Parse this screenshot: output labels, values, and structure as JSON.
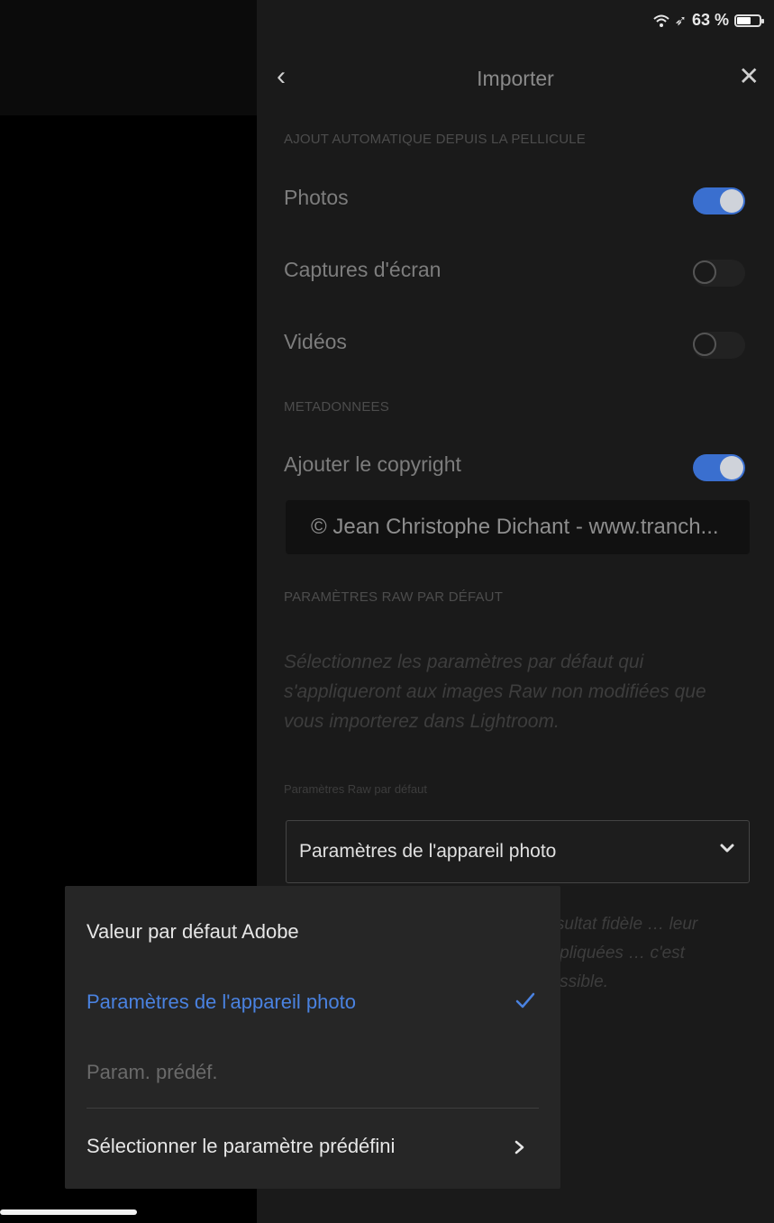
{
  "status_bar": {
    "wifi_icon": "wifi-icon",
    "location_icon": "location-arrow-icon",
    "battery_text": "63 %",
    "battery_level": 0.63
  },
  "header": {
    "back_icon": "chevron-left-icon",
    "title": "Importer",
    "close_icon": "close-icon"
  },
  "auto_add": {
    "section_label": "AJOUT AUTOMATIQUE DEPUIS LA PELLICULE",
    "rows": [
      {
        "label": "Photos",
        "on": true
      },
      {
        "label": "Captures d'écran",
        "on": false
      },
      {
        "label": "Vidéos",
        "on": false
      }
    ]
  },
  "metadata": {
    "section_label": "METADONNEES",
    "copyright_label": "Ajouter le copyright",
    "copyright_on": true,
    "copyright_value": "© Jean Christophe Dichant - www.tranch..."
  },
  "raw_defaults": {
    "section_label": "PARAMÈTRES RAW PAR DÉFAUT",
    "description": "Sélectionnez les paramètres par défaut qui s'appliqueront aux images Raw non modifiées que vous importerez dans Lightroom.",
    "small_label": "Paramètres Raw par défaut",
    "selected": "Paramètres de l'appareil photo",
    "partial_text": "résultat fidèle … leur appliquées … c'est possible."
  },
  "menu": {
    "items": [
      {
        "label": "Valeur par défaut Adobe",
        "state": "default"
      },
      {
        "label": "Paramètres de l'appareil photo",
        "state": "selected"
      },
      {
        "label": "Param. prédéf.",
        "state": "disabled"
      },
      {
        "label": "Sélectionner le paramètre prédéfini",
        "state": "submenu"
      }
    ]
  },
  "colors": {
    "accent": "#4a82e0",
    "toggle_on": "#3a6fcf",
    "panel_bg": "#1a1a1a",
    "popover_bg": "#262626"
  }
}
